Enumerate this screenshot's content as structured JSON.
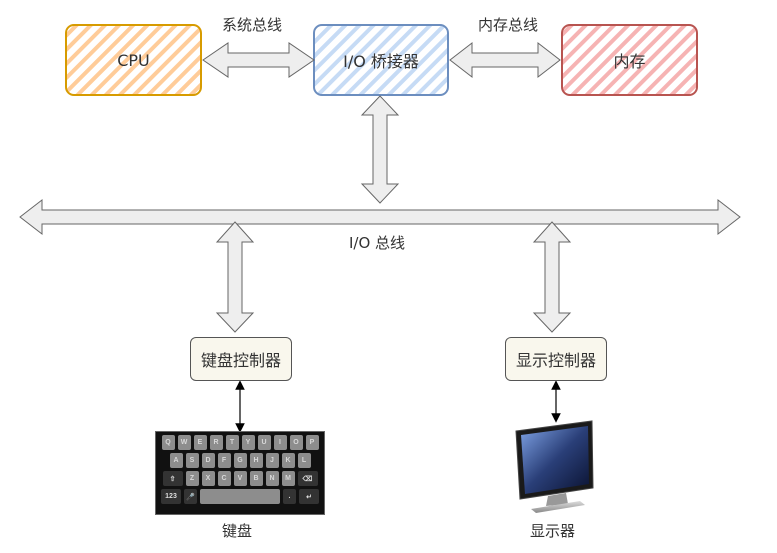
{
  "nodes": {
    "cpu": {
      "label": "CPU",
      "color": "#d79b00",
      "fill": "#ffcc99"
    },
    "bridge": {
      "label": "I/O 桥接器",
      "color": "#6c8ebf",
      "fill": "#b9d2f0"
    },
    "memory": {
      "label": "内存",
      "color": "#b85450",
      "fill": "#f4a6a6"
    },
    "keyboard_controller": {
      "label": "键盘控制器"
    },
    "display_controller": {
      "label": "显示控制器"
    }
  },
  "buses": {
    "system_bus": "系统总线",
    "memory_bus": "内存总线",
    "io_bus": "I/O 总线"
  },
  "devices": {
    "keyboard": {
      "label": "键盘",
      "rows": [
        [
          "Q",
          "W",
          "E",
          "R",
          "T",
          "Y",
          "U",
          "I",
          "O",
          "P"
        ],
        [
          "A",
          "S",
          "D",
          "F",
          "G",
          "H",
          "J",
          "K",
          "L"
        ],
        [
          "⇧",
          "Z",
          "X",
          "C",
          "V",
          "B",
          "N",
          "M",
          "⌫"
        ],
        [
          "123",
          "🎤",
          " ",
          ".",
          "↵"
        ]
      ]
    },
    "monitor": {
      "label": "显示器"
    }
  }
}
